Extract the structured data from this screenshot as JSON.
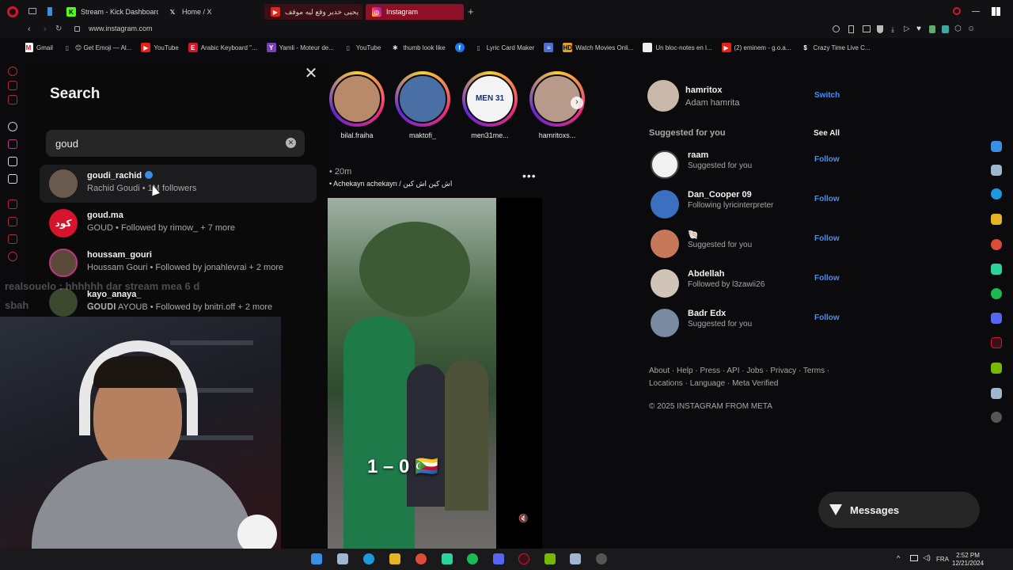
{
  "browser": {
    "tabs": [
      {
        "label": "Stream - Kick Dashboard",
        "icon": "kick-icon"
      },
      {
        "label": "Home / X",
        "icon": "x-icon"
      },
      {
        "label": "يحيى خدير وقع ليه موقف",
        "icon": "youtube-icon"
      },
      {
        "label": "Instagram",
        "icon": "instagram-icon"
      }
    ],
    "new_tab": "+",
    "url": "www.instagram.com",
    "bookmarks": [
      {
        "label": "Gmail",
        "icon": "gmail-icon"
      },
      {
        "label": "😊 Get Emoji — Al...",
        "icon": "emoji-icon"
      },
      {
        "label": "YouTube",
        "icon": "youtube-icon"
      },
      {
        "label": "Arabic Keyboard \"...",
        "icon": "keyboard-icon"
      },
      {
        "label": "Yamli - Moteur de...",
        "icon": "yamli-icon"
      },
      {
        "label": "YouTube",
        "icon": "page-icon"
      },
      {
        "label": "thumb look like",
        "icon": "pin-icon"
      },
      {
        "label": "",
        "icon": "facebook-icon"
      },
      {
        "label": "Lyric Card Maker",
        "icon": "page-icon"
      },
      {
        "label": "",
        "icon": "doc-icon"
      },
      {
        "label": "Watch Movies Onli...",
        "icon": "hd-icon"
      },
      {
        "label": "Un bloc-notes en l...",
        "icon": "note-icon"
      },
      {
        "label": "(2) eminem - g.o.a...",
        "icon": "youtube-icon"
      },
      {
        "label": "Crazy Time Live C...",
        "icon": "dollar-icon"
      }
    ]
  },
  "search_panel": {
    "title": "Search",
    "query": "goud",
    "results": [
      {
        "username": "goudi_rachid",
        "verified": true,
        "subtitle": "Rachid Goudi • 1M followers",
        "avatar_color": "#6b5a4e"
      },
      {
        "username": "goud.ma",
        "verified": false,
        "subtitle": "GOUD • Followed by rimow_ + 7 more",
        "avatar_color": "#d6142b",
        "avatar_text": "كود"
      },
      {
        "username": "houssam_gouri",
        "verified": false,
        "subtitle": "Houssam Gouri • Followed by jonahlevrai + 2 more",
        "avatar_color": "#5a4a3a"
      },
      {
        "username": "kayo_anaya_",
        "verified": false,
        "subtitle": "𝐆𝐎𝐔𝐃𝐈 AYOUB • Followed by bnitri.off + 2 more",
        "avatar_color": "#3b4a2e"
      }
    ]
  },
  "stream_overlay": {
    "chat_line_1": "realsouelo : hhhhhh dar stream mea 6 d",
    "chat_line_2": "sbah"
  },
  "feed": {
    "stories": [
      {
        "name": "bilal.fraiha",
        "color": "#b88a6a"
      },
      {
        "name": "maktofi_",
        "color": "#4a6fa5"
      },
      {
        "name": "men31me...",
        "color": "#f4f4f4",
        "badge": "MEN 31"
      },
      {
        "name": "hamritoxs...",
        "color": "#b89a8a"
      }
    ],
    "post": {
      "time": "• 20m",
      "caption": "• Achekayn achekayn / اش كين اش كين",
      "overlay_text": "1 – 0 🇰🇲",
      "more": "•••"
    }
  },
  "sidebar": {
    "me": {
      "username": "hamritox",
      "name": "Adam hamrita",
      "action": "Switch"
    },
    "suggested_title": "Suggested for you",
    "see_all": "See All",
    "suggestions": [
      {
        "username": "raam",
        "subtitle": "Suggested for you",
        "action": "Follow",
        "avatar_color": "#f2f2f2"
      },
      {
        "username": "Dan_Cooper 09",
        "subtitle": "Following lyricinterpreter",
        "action": "Follow",
        "avatar_color": "#3b6fbf"
      },
      {
        "username": "🐚",
        "subtitle": "Suggested for you",
        "action": "Follow",
        "avatar_color": "#c8785a"
      },
      {
        "username": "Abdellah",
        "subtitle": "Followed by l3zawii26",
        "action": "Follow",
        "avatar_color": "#d0c4b8"
      },
      {
        "username": "Badr Edx",
        "subtitle": "Suggested for you",
        "action": "Follow",
        "avatar_color": "#7a8aa0"
      }
    ],
    "footer_links": "About · Help · Press · API · Jobs · Privacy · Terms · Locations · Language · Meta Verified",
    "copyright": "© 2025 INSTAGRAM FROM META",
    "messages": "Messages"
  },
  "taskbar": {
    "lang": "FRA",
    "time": "2:52 PM",
    "date": "12/21/2024"
  },
  "colors": {
    "accent_link": "#4c8cf5",
    "opera_red": "#d6142b",
    "active_tab": "#8c1026"
  }
}
